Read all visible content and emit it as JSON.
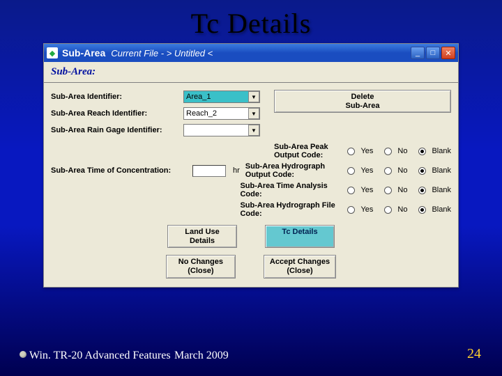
{
  "slide": {
    "title": "Tc Details",
    "footer_left": "Win. TR-20 Advanced Features",
    "footer_center": "March 2009",
    "page_num": "24"
  },
  "win": {
    "app": "Sub-Area",
    "file": "Current File  -  > Untitled <",
    "section": "Sub-Area:"
  },
  "form": {
    "id_label": "Sub-Area Identifier:",
    "id_value": "Area_1",
    "reach_label": "Sub-Area Reach Identifier:",
    "reach_value": "Reach_2",
    "gage_label": "Sub-Area Rain Gage Identifier:",
    "gage_value": "",
    "tc_label": "Sub-Area Time of Concentration:",
    "tc_unit": "hr",
    "delete_btn": "Delete\nSub-Area"
  },
  "opts": {
    "peak": "Sub-Area Peak Output Code:",
    "hydro": "Sub-Area Hydrograph Output Code:",
    "time": "Sub-Area Time Analysis Code:",
    "file": "Sub-Area Hydrograph File Code:",
    "yes": "Yes",
    "no": "No",
    "blank": "Blank"
  },
  "buttons": {
    "landuse": "Land Use\nDetails",
    "tcdetails": "Tc Details",
    "nochanges": "No Changes\n(Close)",
    "accept": "Accept Changes\n(Close)"
  }
}
